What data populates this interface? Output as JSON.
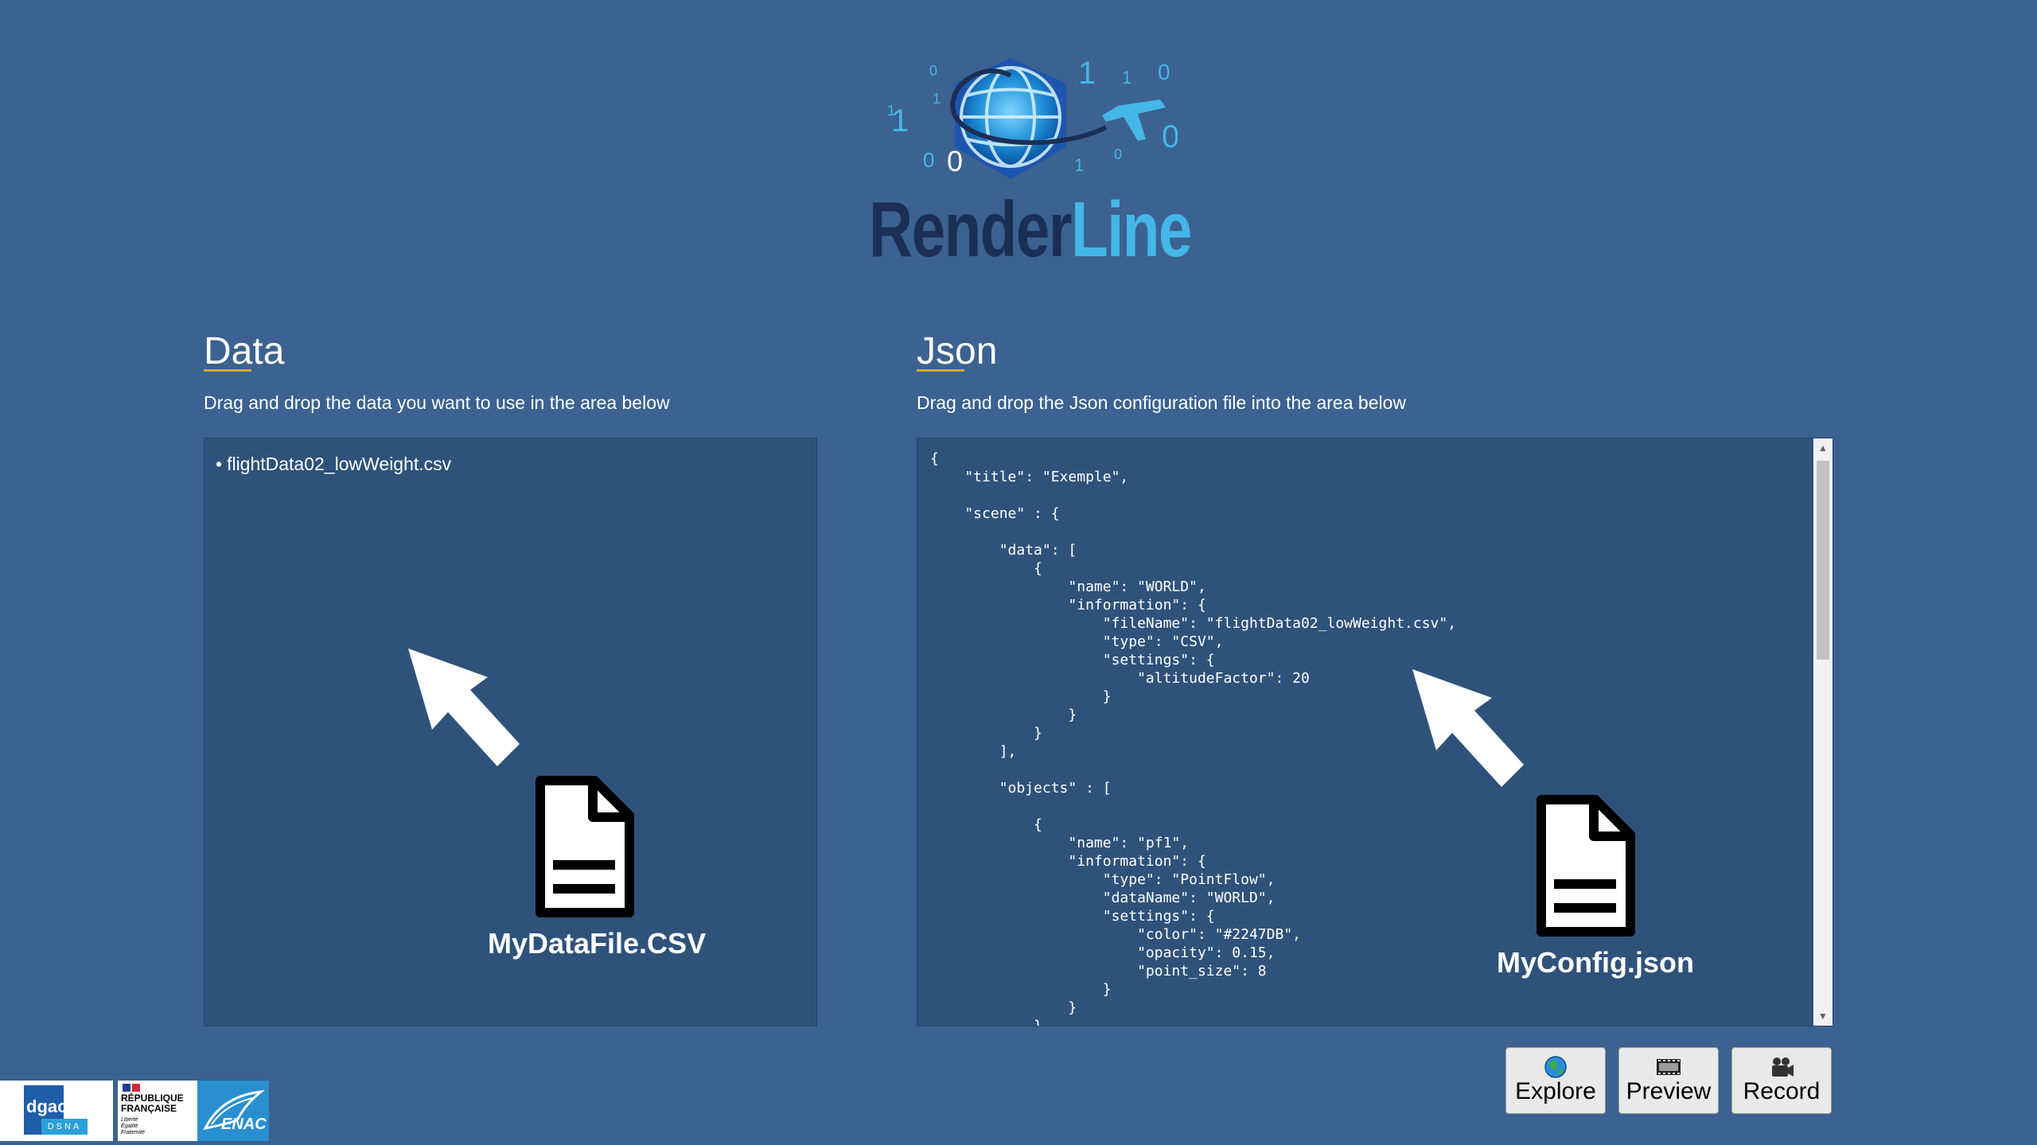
{
  "app": {
    "logo_text_part1": "Render",
    "logo_text_part2": "Line",
    "logo_digits": [
      "1",
      "1",
      "0",
      "1",
      "0",
      "1",
      "0",
      "0",
      "1",
      "0",
      "1",
      "0",
      "1"
    ]
  },
  "data_section": {
    "title": "Data",
    "description": "Drag and drop the data you want to use in the area below",
    "files": [
      "flightData02_lowWeight.csv"
    ],
    "overlay_caption": "MyDataFile.CSV"
  },
  "json_section": {
    "title": "Json",
    "description": "Drag and drop the Json configuration file into the area below",
    "content": "{\n    \"title\": \"Exemple\",\n\n    \"scene\" : {\n\n        \"data\": [\n            {\n                \"name\": \"WORLD\",\n                \"information\": {\n                    \"fileName\": \"flightData02_lowWeight.csv\",\n                    \"type\": \"CSV\",\n                    \"settings\": {\n                        \"altitudeFactor\": 20\n                    }\n                }\n            }\n        ],\n\n        \"objects\" : [\n\n            {\n                \"name\": \"pf1\",\n                \"information\": {\n                    \"type\": \"PointFlow\",\n                    \"dataName\": \"WORLD\",\n                    \"settings\": {\n                        \"color\": \"#2247DB\",\n                        \"opacity\": 0.15,\n                        \"point_size\": 8\n                    }\n                }\n            },",
    "overlay_caption": "MyConfig.json"
  },
  "buttons": {
    "explore": {
      "label": "Explore",
      "icon": "globe-icon"
    },
    "preview": {
      "label": "Preview",
      "icon": "film-icon"
    },
    "record": {
      "label": "Record",
      "icon": "camera-icon"
    }
  },
  "footer": {
    "dgac_text": "dgac",
    "dsna_text": "DSNA",
    "republic_line1": "RÉPUBLIQUE",
    "republic_line2": "FRANÇAISE",
    "motto_line1": "Liberté",
    "motto_line2": "Égalité",
    "motto_line3": "Fraternité",
    "enac_text": "ENAC"
  },
  "colors": {
    "background": "#3b6290",
    "dropzone": "#2f527a",
    "accent_underline": "#d4a93c",
    "logo_dark": "#1b2f55",
    "logo_light": "#44b6e8"
  }
}
